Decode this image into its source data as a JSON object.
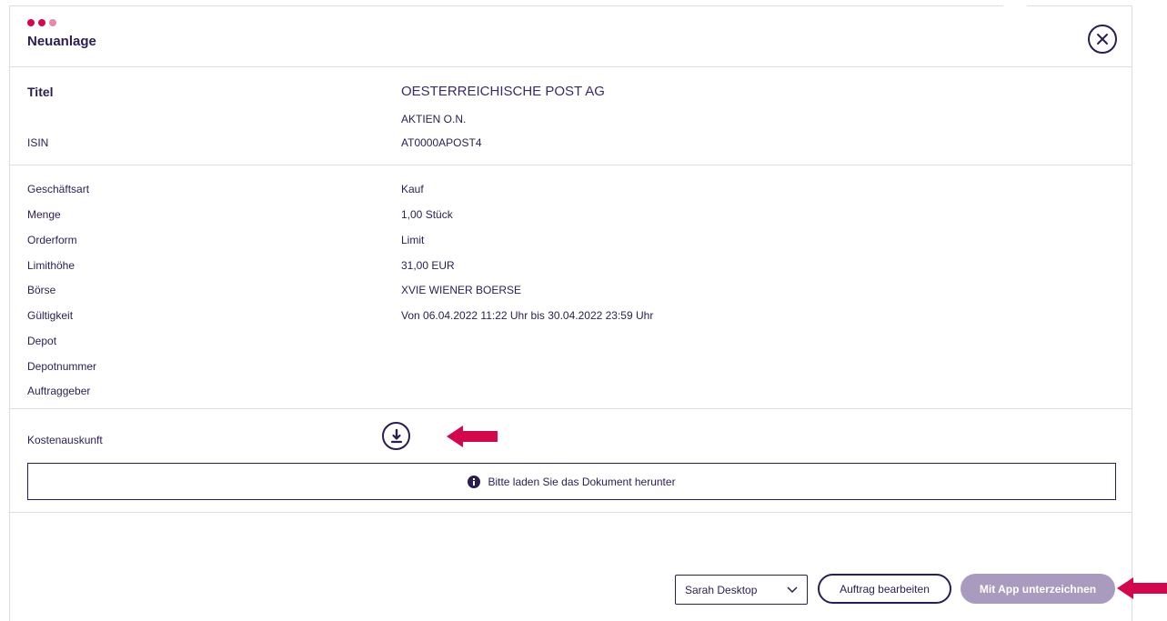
{
  "dialog": {
    "title": "Neuanlage",
    "dot_colors": [
      "#d3074e",
      "#d3074e",
      "#e78aa8"
    ]
  },
  "security": {
    "title_label": "Titel",
    "title_line1": "OESTERREICHISCHE POST AG",
    "title_line2": "AKTIEN O.N.",
    "isin_label": "ISIN",
    "isin_value": "AT0000APOST4"
  },
  "order": {
    "fields": [
      {
        "label": "Geschäftsart",
        "value": "Kauf"
      },
      {
        "label": "Menge",
        "value": "1,00 Stück"
      },
      {
        "label": "Orderform",
        "value": "Limit"
      },
      {
        "label": "Limithöhe",
        "value": "31,00 EUR"
      },
      {
        "label": "Börse",
        "value": "XVIE WIENER BOERSE"
      },
      {
        "label": "Gültigkeit",
        "value": "Von 06.04.2022 11:22 Uhr bis 30.04.2022 23:59 Uhr"
      },
      {
        "label": "Depot",
        "value": ""
      },
      {
        "label": "Depotnummer",
        "value": ""
      },
      {
        "label": "Auftraggeber",
        "value": ""
      }
    ]
  },
  "costs": {
    "label": "Kostenauskunft",
    "download_icon": "download-icon",
    "info_text": "Bitte laden Sie das Dokument herunter"
  },
  "footer": {
    "device_select": "Sarah Desktop",
    "edit_button": "Auftrag bearbeiten",
    "sign_button": "Mit App unterzeichnen"
  },
  "colors": {
    "accent": "#d3074e",
    "primary": "#2b1d52",
    "disabled": "#a99bbd"
  }
}
